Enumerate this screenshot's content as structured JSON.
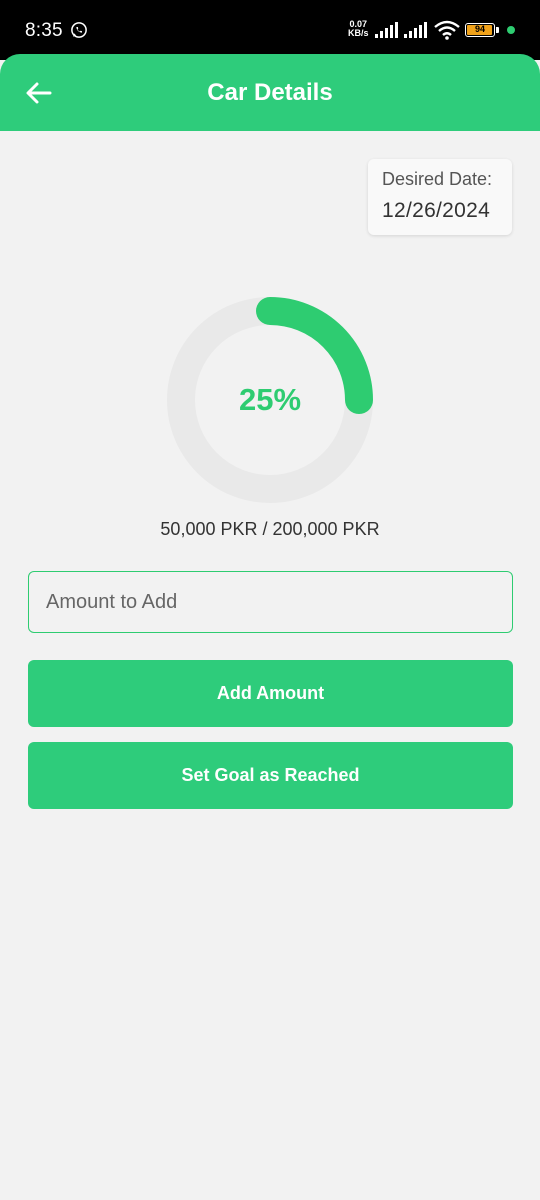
{
  "status_bar": {
    "time": "8:35",
    "net_speed_value": "0.07",
    "net_speed_unit": "KB/s",
    "battery_level": "94",
    "icons": [
      "whatsapp-icon",
      "signal-icon",
      "signal-icon",
      "wifi-icon",
      "battery-icon"
    ]
  },
  "header": {
    "title": "Car Details",
    "back_icon": "arrow-left-icon"
  },
  "goal": {
    "desired_date_label": "Desired Date:",
    "desired_date": "12/26/2024",
    "progress_percent_label": "25%",
    "progress_fraction": 0.25,
    "amount_summary": "50,000 PKR / 200,000 PKR"
  },
  "form": {
    "amount_input_placeholder": "Amount to Add",
    "amount_input_value": ""
  },
  "actions": {
    "add_amount_label": "Add Amount",
    "set_goal_reached_label": "Set Goal as Reached"
  },
  "colors": {
    "accent": "#2ecc71",
    "header_bg": "#2ecc7b",
    "ring_track": "#e9e9e9",
    "background": "#f2f2f2",
    "battery": "#f0a21a"
  }
}
